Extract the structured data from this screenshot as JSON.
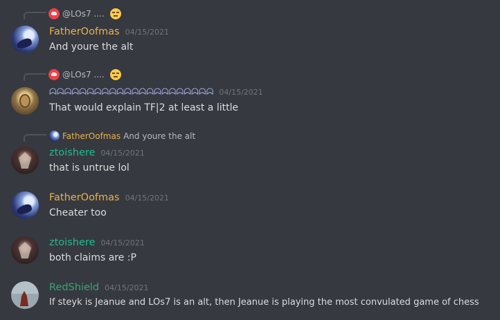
{
  "messages": [
    {
      "reply": {
        "name": "@LOs7 ....",
        "emoji": "expressionless-face"
      },
      "username": "FatherOofmas",
      "timestamp": "04/15/2021",
      "content": "And youre the alt",
      "colors": {
        "username": "#e9b34b"
      }
    },
    {
      "reply": {
        "name": "@LOs7 ....",
        "emoji": "expressionless-face"
      },
      "username": "ᗣᗣᗣᗣᗣᗣᗣᗣᗣᗣᗣᗣᗣᗣᗣᗣᗣᗣᗣᗣᗣᗣ",
      "timestamp": "04/15/2021",
      "content": "That would explain TF|2 at least a little",
      "colors": {
        "username": "#9ba6dc"
      }
    },
    {
      "reply": {
        "name": "FatherOofmas",
        "content": "And youre the alt"
      },
      "username": "ztoishere",
      "timestamp": "04/15/2021",
      "content": "that is untrue lol",
      "colors": {
        "username": "#1fbc94"
      }
    },
    {
      "username": "FatherOofmas",
      "timestamp": "04/15/2021",
      "content": "Cheater too",
      "colors": {
        "username": "#e9b34b"
      }
    },
    {
      "username": "ztoishere",
      "timestamp": "04/15/2021",
      "content": "both claims are :P",
      "colors": {
        "username": "#1fbc94"
      }
    },
    {
      "username": "RedShield",
      "timestamp": "04/15/2021",
      "content": "If steyk is Jeanue and LOs7 is an alt, then Jeanue is playing the most convulated game of chess",
      "colors": {
        "username": "#39a47a"
      }
    }
  ],
  "colors": {
    "background": "#36393f",
    "text": "#dcddde",
    "muted": "#72767d",
    "reply_line": "#4f545c"
  }
}
